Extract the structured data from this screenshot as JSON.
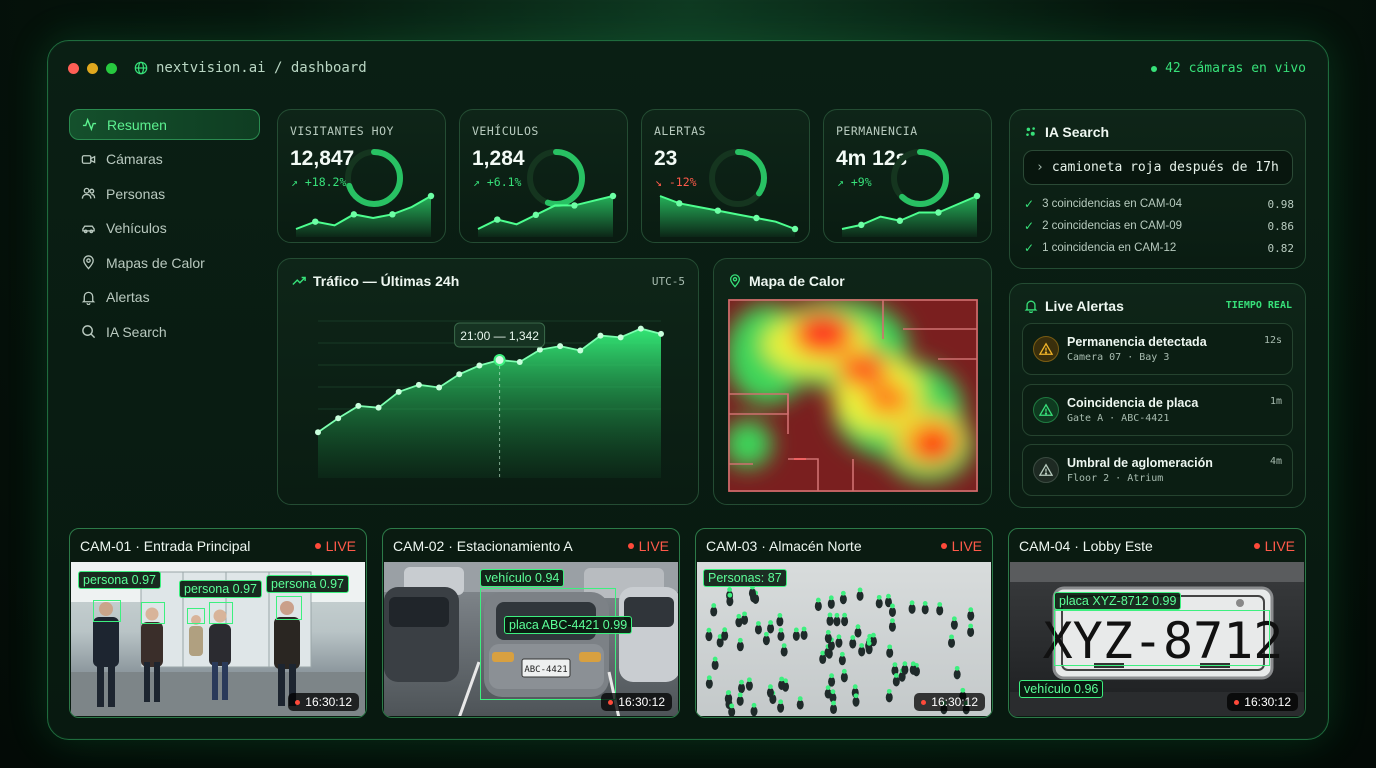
{
  "window": {
    "url": "nextvision.ai / dashboard",
    "live_cameras": "42 cámaras en vivo",
    "colors": {
      "accent": "#37e079",
      "red": "#ff5f56",
      "yellow": "#e0a81e",
      "green": "#27c93f"
    }
  },
  "sidebar": {
    "items": [
      {
        "label": "Resumen",
        "icon": "activity-icon",
        "active": true
      },
      {
        "label": "Cámaras",
        "icon": "video-icon"
      },
      {
        "label": "Personas",
        "icon": "users-icon"
      },
      {
        "label": "Vehículos",
        "icon": "car-icon"
      },
      {
        "label": "Mapas de Calor",
        "icon": "map-pin-icon"
      },
      {
        "label": "Alertas",
        "icon": "bell-icon"
      },
      {
        "label": "IA Search",
        "icon": "search-icon"
      }
    ]
  },
  "kpis": [
    {
      "label": "VISITANTES HOY",
      "value": "12,847",
      "change": "↗ +18.2%",
      "trend": "up",
      "gauge": 0.7,
      "spark": [
        3,
        5,
        4,
        7,
        6,
        7,
        9,
        12
      ]
    },
    {
      "label": "VEHÍCULOS",
      "value": "1,284",
      "change": "↗ +6.1%",
      "trend": "up",
      "gauge": 0.55,
      "spark": [
        3,
        5,
        4,
        6,
        8,
        8,
        9,
        10
      ]
    },
    {
      "label": "ALERTAS",
      "value": "23",
      "change": "↘ -12%",
      "trend": "down",
      "gauge": 0.35,
      "spark": [
        12,
        10,
        9,
        8,
        7,
        6,
        5,
        3
      ]
    },
    {
      "label": "PERMANENCIA",
      "value": "4m 12s",
      "change": "↗ +9%",
      "trend": "up",
      "gauge": 0.62,
      "spark": [
        3,
        4,
        6,
        5,
        7,
        7,
        9,
        11
      ]
    }
  ],
  "traffic": {
    "title": "Tráfico — Últimas 24h",
    "timezone": "UTC-5",
    "tooltip": "21:00 — 1,342"
  },
  "chart_data": {
    "type": "area",
    "title": "Tráfico — Últimas 24h",
    "values": [
      520,
      680,
      820,
      800,
      980,
      1060,
      1030,
      1180,
      1280,
      1342,
      1320,
      1460,
      1500,
      1450,
      1620,
      1600,
      1700,
      1640
    ],
    "highlight_index": 9,
    "ylim": [
      0,
      1900
    ],
    "grid": true
  },
  "heatmap": {
    "title": "Mapa de Calor"
  },
  "ia_search": {
    "title": "IA Search",
    "query": "camioneta roja después de 17h",
    "matches": [
      {
        "text": "3 coincidencias en CAM-04",
        "score": "0.98"
      },
      {
        "text": "2 coincidencias en CAM-09",
        "score": "0.86"
      },
      {
        "text": "1 coincidencia en CAM-12",
        "score": "0.82"
      }
    ]
  },
  "live_alerts": {
    "title": "Live Alertas",
    "badge": "TIEMPO REAL",
    "items": [
      {
        "title": "Permanencia detectada",
        "sub": "Camera 07 · Bay 3",
        "time": "12s",
        "level": "warning"
      },
      {
        "title": "Coincidencia de placa",
        "sub": "Gate A · ABC-4421",
        "time": "1m",
        "level": "success"
      },
      {
        "title": "Umbral de aglomeración",
        "sub": "Floor 2 · Atrium",
        "time": "4m",
        "level": "neutral"
      }
    ]
  },
  "cameras": [
    {
      "title": "CAM-01 · Entrada Principal",
      "live": "LIVE",
      "time": "16:30:12",
      "tags": [
        "persona 0.97",
        "persona 0.97",
        "persona 0.97"
      ]
    },
    {
      "title": "CAM-02 · Estacionamiento A",
      "live": "LIVE",
      "time": "16:30:12",
      "tags": [
        "vehículo 0.94",
        "placa ABC-4421 0.99"
      ],
      "plate": "ABC-4421"
    },
    {
      "title": "CAM-03 · Almacén Norte",
      "live": "LIVE",
      "time": "16:30:12",
      "tags": [
        "Personas: 87"
      ]
    },
    {
      "title": "CAM-04 · Lobby Este",
      "live": "LIVE",
      "time": "16:30:12",
      "tags": [
        "placa XYZ-8712 0.99",
        "vehículo 0.96"
      ],
      "plate": "XYZ-8712"
    }
  ]
}
